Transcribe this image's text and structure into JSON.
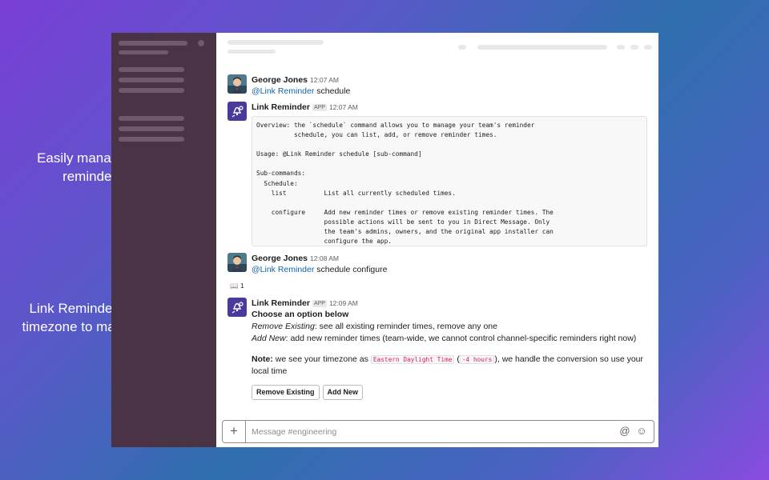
{
  "captions": {
    "top": "Easily manage your team’s reminder schedule",
    "bottom": "Link Reminder detects your timezone to make things easy"
  },
  "messages": [
    {
      "author": "George Jones",
      "time": "12:07 AM",
      "mention": "@Link Reminder",
      "text": " schedule"
    },
    {
      "author": "Link Reminder",
      "app_tag": "APP",
      "time": "12:07 AM",
      "code": "Overview: the `schedule` command allows you to manage your team's reminder\n          schedule, you can list, add, or remove reminder times.\n\nUsage: @Link Reminder schedule [sub-command]\n\nSub-commands:\n  Schedule:\n    list          List all currently scheduled times.\n\n    configure     Add new reminder times or remove existing reminder times. The\n                  possible actions will be sent to you in Direct Message. Only\n                  the team's admins, owners, and the original app installer can\n                  configure the app."
    },
    {
      "author": "George Jones",
      "time": "12:08 AM",
      "mention": "@Link Reminder",
      "text": " schedule configure",
      "reaction_emoji": "📖",
      "reaction_count": "1"
    },
    {
      "author": "Link Reminder",
      "app_tag": "APP",
      "time": "12:09 AM",
      "title": "Choose an option below",
      "line1_em": "Remove Existing",
      "line1_rest": ": see all existing reminder times, remove any one",
      "line2_em": "Add New",
      "line2_rest": ": add new reminder times (team-wide, we cannot control channel-specific reminders right now)",
      "note_label": "Note:",
      "note_a": " we see your timezone as ",
      "tz": "Eastern Daylight Time",
      "note_b": " (",
      "offset": "-4 hours",
      "note_c": "), we handle the conversion so use your local time",
      "btn_remove": "Remove Existing",
      "btn_add": "Add New"
    }
  ],
  "composer": {
    "plus": "+",
    "placeholder": "Message #engineering",
    "at_icon": "@",
    "emoji_icon": "☺"
  },
  "icons": {
    "avatar_person": "person-avatar-icon",
    "avatar_app": "link-reminder-app-icon"
  },
  "colors": {
    "sidebar": "#4b3346",
    "mention": "#1264a3",
    "inline_code": "#e01e5a",
    "app_avatar": "#4a3a9c"
  }
}
